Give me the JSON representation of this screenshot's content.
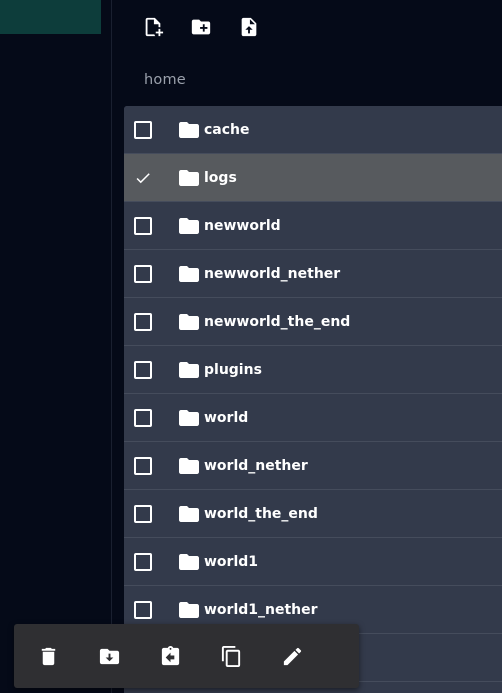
{
  "breadcrumb": {
    "path": "home"
  },
  "files": [
    {
      "name": "cache",
      "checked": false
    },
    {
      "name": "logs",
      "checked": true
    },
    {
      "name": "newworld",
      "checked": false
    },
    {
      "name": "newworld_nether",
      "checked": false
    },
    {
      "name": "newworld_the_end",
      "checked": false
    },
    {
      "name": "plugins",
      "checked": false
    },
    {
      "name": "world",
      "checked": false
    },
    {
      "name": "world_nether",
      "checked": false
    },
    {
      "name": "world_the_end",
      "checked": false
    },
    {
      "name": "world1",
      "checked": false
    },
    {
      "name": "world1_nether",
      "checked": false
    },
    {
      "name": "",
      "checked": false
    }
  ],
  "icons": {
    "toolbar": [
      "new-file-icon",
      "new-folder-icon",
      "upload-file-icon"
    ],
    "actions": [
      "delete-icon",
      "move-icon",
      "paste-icon",
      "copy-icon",
      "rename-icon"
    ]
  },
  "colors": {
    "background": "#050a18",
    "sidebar_active": "#0d3d3b",
    "list_background": "#333a4b",
    "selected_row": "#575a5e",
    "action_bar": "#2f2f32"
  }
}
